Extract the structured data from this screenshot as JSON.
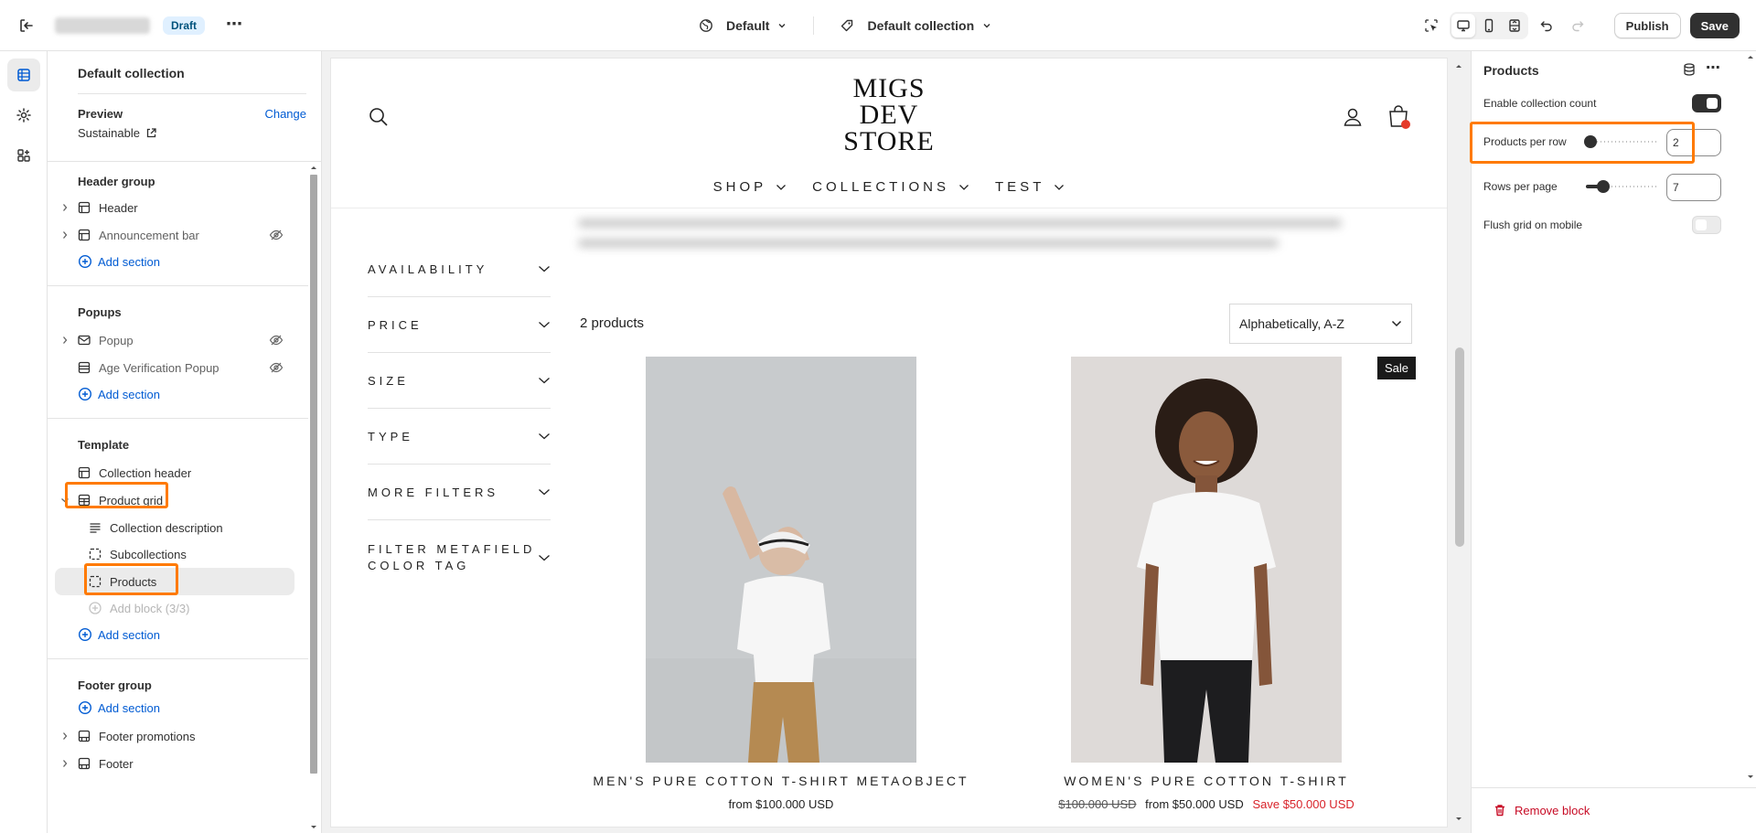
{
  "topbar": {
    "badge": "Draft",
    "more": "⋯",
    "theme_dropdown": "Default",
    "template_dropdown": "Default collection",
    "publish_label": "Publish",
    "save_label": "Save"
  },
  "sidebar": {
    "title": "Default collection",
    "preview_label": "Preview",
    "change_label": "Change",
    "preview_value": "Sustainable",
    "header_group": {
      "heading": "Header group",
      "items": [
        "Header",
        "Announcement bar"
      ],
      "add_section": "Add section"
    },
    "popups": {
      "heading": "Popups",
      "items": [
        "Popup",
        "Age Verification Popup"
      ],
      "add_section": "Add section"
    },
    "template": {
      "heading": "Template",
      "items": [
        "Collection header",
        "Product grid"
      ],
      "blocks": [
        "Collection description",
        "Subcollections",
        "Products"
      ],
      "add_block": "Add block (3/3)",
      "add_section": "Add section"
    },
    "footer_group": {
      "heading": "Footer group",
      "add_section": "Add section",
      "items": [
        "Footer promotions",
        "Footer"
      ]
    }
  },
  "preview": {
    "logo_lines": [
      "MIGS",
      "DEV",
      "STORE"
    ],
    "nav": [
      "SHOP",
      "COLLECTIONS",
      "TEST"
    ],
    "filters": [
      "AVAILABILITY",
      "PRICE",
      "SIZE",
      "TYPE",
      "MORE FILTERS"
    ],
    "filter_metafield": [
      "FILTER METAFIELD",
      "COLOR TAG"
    ],
    "product_count": "2 products",
    "sort_value": "Alphabetically, A-Z",
    "sale_badge": "Sale",
    "products": [
      {
        "title": "MEN'S PURE COTTON T-SHIRT METAOBJECT",
        "price": "from $100.000 USD"
      },
      {
        "title": "WOMEN'S PURE COTTON T-SHIRT",
        "compare_price": "$100.000 USD",
        "price": "from $50.000 USD",
        "sale_price": "Save $50.000 USD"
      }
    ]
  },
  "settings": {
    "title": "Products",
    "enable_collection_count": {
      "label": "Enable collection count",
      "value": true
    },
    "products_per_row": {
      "label": "Products per row",
      "value": "2",
      "min": 2,
      "max": 5,
      "level": 0
    },
    "rows_per_page": {
      "label": "Rows per page",
      "value": "7",
      "min": 4,
      "max": 20,
      "level": 0.2
    },
    "flush_grid_mobile": {
      "label": "Flush grid on mobile",
      "value": false
    },
    "remove_block": "Remove block"
  },
  "colors": {
    "accent_link": "#005bd3",
    "highlight": "#ff7a00",
    "danger": "#c70a24",
    "sale_red": "#d8232a"
  }
}
